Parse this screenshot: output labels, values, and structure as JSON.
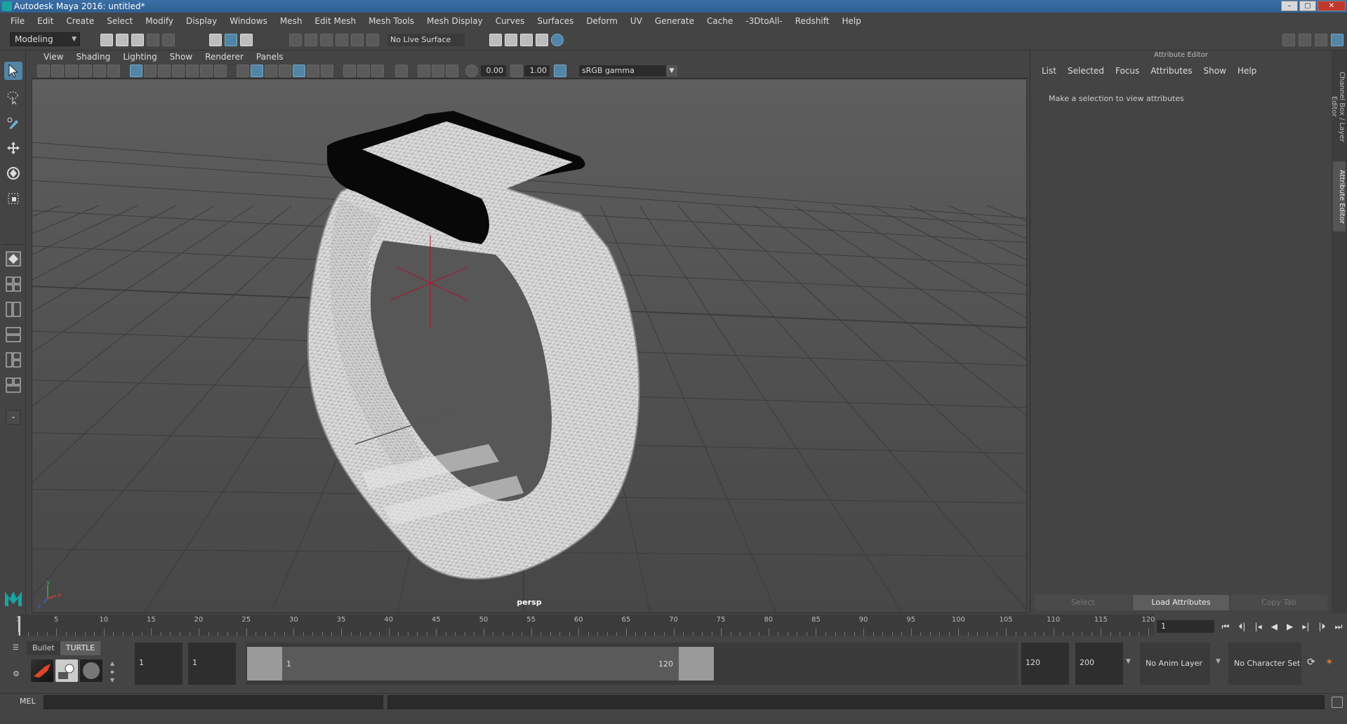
{
  "window": {
    "title": "Autodesk Maya 2016: untitled*",
    "controls": [
      "–",
      "▢",
      "✕"
    ]
  },
  "menubar": {
    "items": [
      "File",
      "Edit",
      "Create",
      "Select",
      "Modify",
      "Display",
      "Windows",
      "Mesh",
      "Edit Mesh",
      "Mesh Tools",
      "Mesh Display",
      "Curves",
      "Surfaces",
      "Deform",
      "UV",
      "Generate",
      "Cache",
      "-3DtoAll-",
      "Redshift",
      "Help"
    ]
  },
  "statusline": {
    "mode": "Modeling",
    "live_surface": "No Live Surface"
  },
  "viewport": {
    "menu": [
      "View",
      "Shading",
      "Lighting",
      "Show",
      "Renderer",
      "Panels"
    ],
    "exposure": "0.00",
    "gamma": "1.00",
    "color_space": "sRGB gamma",
    "camera_label": "persp",
    "axis_labels": {
      "x": "x",
      "y": "y",
      "z": "z"
    },
    "colors": {
      "band": "#d6d6d6",
      "band_dark": "#a8a8a8",
      "device": "#0a0a0a",
      "grid": "#3c3c3c",
      "pivot": "#b3122b"
    }
  },
  "attribute_editor": {
    "title": "Attribute Editor",
    "menu": [
      "List",
      "Selected",
      "Focus",
      "Attributes",
      "Show",
      "Help"
    ],
    "message": "Make a selection to view attributes",
    "buttons": {
      "select": "Select",
      "load": "Load Attributes",
      "copy": "Copy Tab"
    },
    "side_tabs": {
      "channel_box": "Channel Box / Layer Editor",
      "attribute_editor": "Attribute Editor"
    }
  },
  "timeline": {
    "tick_labels": [
      "1",
      "5",
      "10",
      "15",
      "20",
      "25",
      "30",
      "35",
      "40",
      "45",
      "50",
      "55",
      "60",
      "65",
      "70",
      "75",
      "80",
      "85",
      "90",
      "95",
      "100",
      "105",
      "110",
      "115",
      "120"
    ],
    "current_frame": "1"
  },
  "shelf": {
    "tabs": [
      "Bullet",
      "TURTLE"
    ]
  },
  "range": {
    "start_time": "1",
    "playback_start": "1",
    "range_start_label": "1",
    "range_end_label": "120",
    "playback_end": "120",
    "end_time": "200",
    "anim_layer": "No Anim Layer",
    "character_set": "No Character Set"
  },
  "command": {
    "language": "MEL"
  }
}
